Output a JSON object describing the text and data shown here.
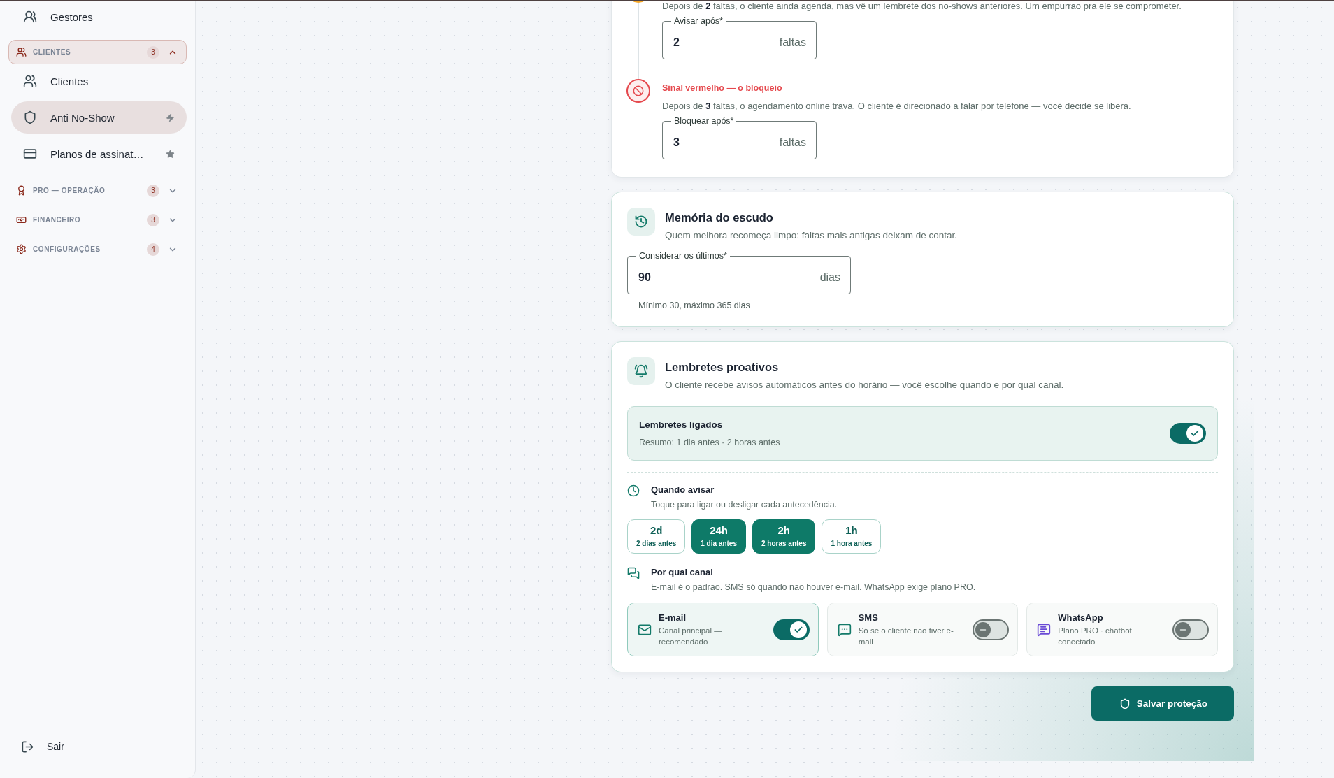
{
  "sidebar": {
    "items": [
      {
        "kind": "link",
        "label": "Gestores",
        "selected": false
      },
      {
        "kind": "group",
        "label": "CLIENTES",
        "count": "3",
        "expanded": true,
        "children": [
          {
            "label": "Clientes",
            "selected": false
          },
          {
            "label": "Anti No-Show",
            "selected": true
          },
          {
            "label": "Planos de assinat…",
            "selected": false
          }
        ]
      },
      {
        "kind": "group",
        "label": "PRO — OPERAÇÃO",
        "count": "3",
        "expanded": false
      },
      {
        "kind": "group",
        "label": "FINANCEIRO",
        "count": "3",
        "expanded": false
      },
      {
        "kind": "group",
        "label": "CONFIGURAÇÕES",
        "count": "4",
        "expanded": false
      }
    ],
    "logout": "Sair"
  },
  "escalation_card": {
    "steps": [
      {
        "kind": "warning",
        "description": "Depois de **2** faltas, o cliente ainda agenda, mas vê um lembrete dos no-shows anteriores. Um empurrão pra ele se comprometer.",
        "field": {
          "label": "Avisar após*",
          "value": "2",
          "suffix": "faltas"
        }
      },
      {
        "kind": "block",
        "title": "Sinal vermelho — o bloqueio",
        "description": "Depois de **3** faltas, o agendamento online trava. O cliente é direcionado a falar por telefone — você decide se libera.",
        "field": {
          "label": "Bloquear após*",
          "value": "3",
          "suffix": "faltas"
        }
      }
    ]
  },
  "memory_card": {
    "title": "Memória do escudo",
    "subtitle": "Quem melhora recomeça limpo: faltas mais antigas deixam de contar.",
    "field": {
      "label": "Considerar os últimos*",
      "value": "90",
      "suffix": "dias"
    },
    "helper": "Mínimo 30, máximo 365 dias"
  },
  "reminders_card": {
    "title": "Lembretes proativos",
    "subtitle": "O cliente recebe avisos automáticos antes do horário — você escolhe quando e por qual canal.",
    "master_toggle": {
      "title": "Lembretes ligados",
      "summary": "Resumo: 1 dia antes · 2 horas antes",
      "on": true
    },
    "timing": {
      "title": "Quando avisar",
      "subtitle": "Toque para ligar ou desligar cada antecedência.",
      "options": [
        {
          "value": "2d",
          "label": "2 dias antes",
          "selected": false
        },
        {
          "value": "24h",
          "label": "1 dia antes",
          "selected": true
        },
        {
          "value": "2h",
          "label": "2 horas antes",
          "selected": true
        },
        {
          "value": "1h",
          "label": "1 hora antes",
          "selected": false
        }
      ]
    },
    "channels": {
      "title": "Por qual canal",
      "subtitle": "E-mail é o padrão. SMS só quando não houver e-mail. WhatsApp exige plano PRO.",
      "items": [
        {
          "name": "E-mail",
          "description": "Canal principal — recomendado",
          "on": true,
          "color": "#137a69"
        },
        {
          "name": "SMS",
          "description": "Só se o cliente não tiver e-mail",
          "on": false,
          "color": "#137a69"
        },
        {
          "name": "WhatsApp",
          "description": "Plano PRO · chatbot conectado",
          "on": false,
          "color": "#6a4bd6"
        }
      ]
    }
  },
  "save_button": {
    "label": "Salvar proteção"
  }
}
